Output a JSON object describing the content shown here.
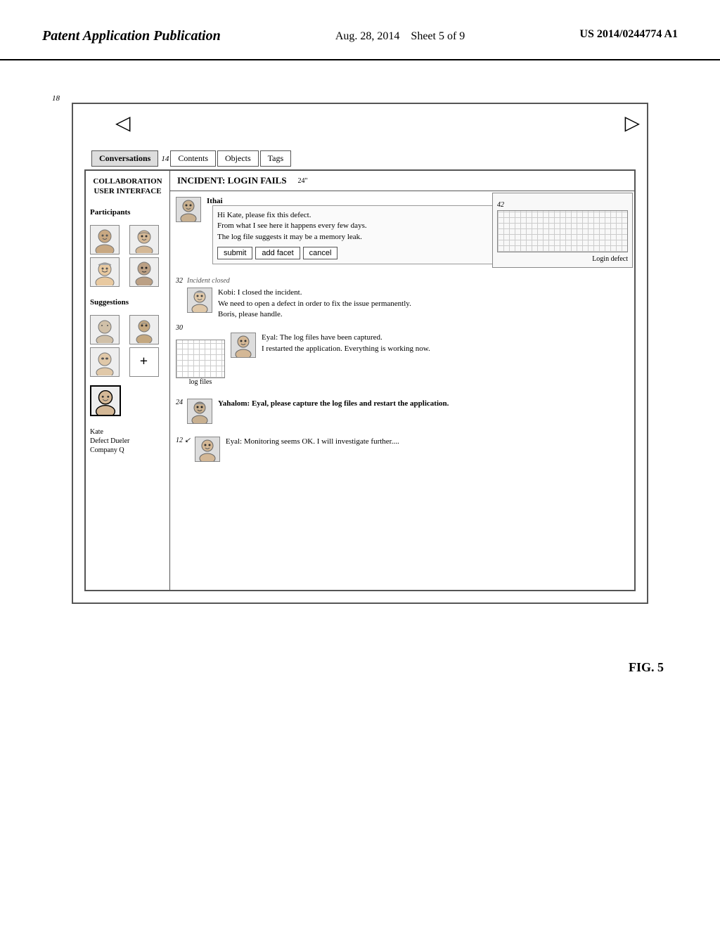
{
  "header": {
    "left": "Patent Application Publication",
    "center_line1": "Aug. 28, 2014",
    "center_line2": "Sheet 5 of 9",
    "right": "US 2014/0244774 A1"
  },
  "figure": {
    "label": "FIG. 5",
    "outer_ref": "18"
  },
  "tabs": [
    {
      "label": "Conversations",
      "active": true
    },
    {
      "label": "Contents"
    },
    {
      "label": "Objects"
    },
    {
      "label": "Tags"
    }
  ],
  "tab_ref": "14",
  "incident": {
    "title": "INCIDENT: LOGIN FAILS",
    "ref": "24\""
  },
  "sidebar": {
    "title_line1": "COLLABORATION",
    "title_line2": "USER INTERFACE",
    "participants_label": "Participants",
    "suggestions_label": "Suggestions",
    "kate_info": {
      "name": "Kate",
      "role": "Defect Dueler",
      "company": "Company Q"
    },
    "plus_label": "+"
  },
  "defect_overlay": {
    "label": "Login defect",
    "ref": "42"
  },
  "chat_messages": [
    {
      "sender": "Ithai",
      "text_lines": [
        "Hi Kate, please fix this defect.",
        "From what I see here it happens every few days.",
        "The log file suggests it may be a memory leak."
      ],
      "form": {
        "submit_label": "submit",
        "add_facet_label": "add facet",
        "cancel_label": "cancel"
      }
    },
    {
      "sender": "Kobi",
      "ref": "32",
      "incident_closed": "Incident closed",
      "text_lines": [
        "Kobi: I closed the incident.",
        "We need to open a defect in order to fix the issue permanently.",
        "Boris, please handle."
      ]
    },
    {
      "sender": "Eyal",
      "ref": "30",
      "log_files_label": "log files",
      "text_lines": [
        "Eyal: The log files have been captured.",
        "I restarted the application. Everything is working now."
      ]
    },
    {
      "sender": "Yahalom",
      "ref": "24",
      "text_lines": [
        "Yahalom: Eyal, please capture the log files and restart the application."
      ]
    },
    {
      "sender": "Eyal",
      "ref": "12",
      "text_lines": [
        "Eyal: Monitoring seems OK. I will investigate further...."
      ]
    }
  ],
  "nav": {
    "left_arrow": "◁",
    "right_arrow": "▷"
  }
}
